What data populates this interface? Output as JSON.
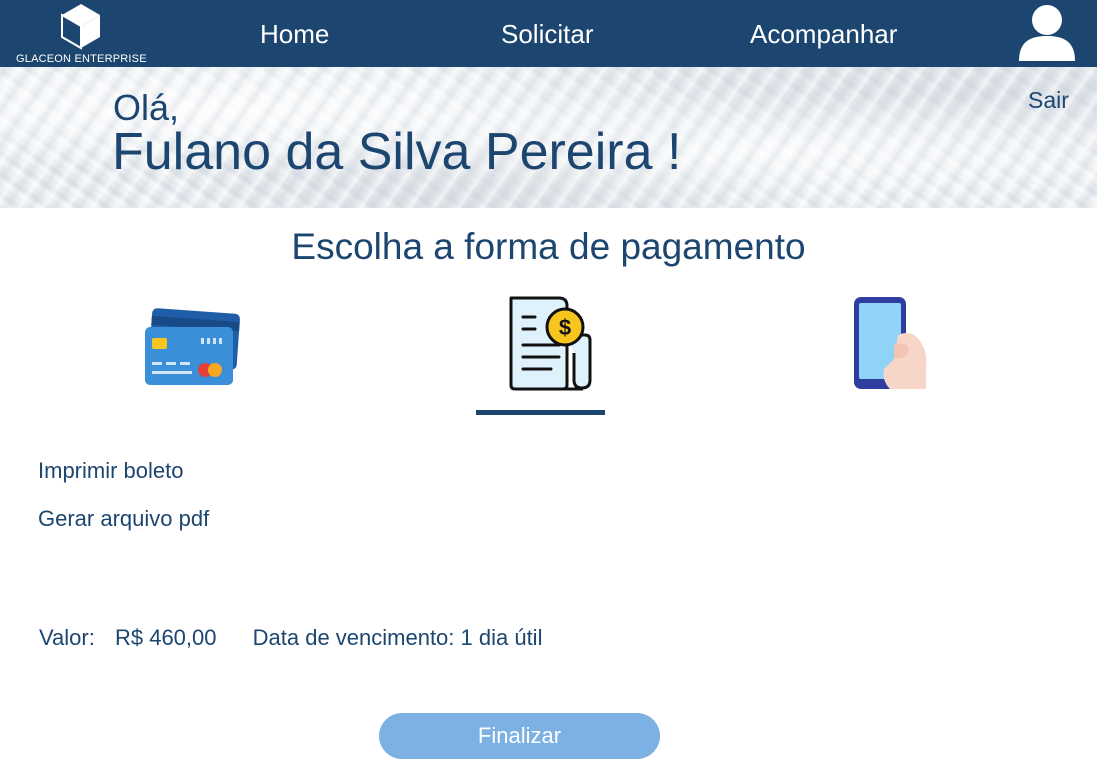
{
  "brand": {
    "name": "GLACEON ENTERPRISE"
  },
  "nav": {
    "items": [
      {
        "label": "Home"
      },
      {
        "label": "Solicitar"
      },
      {
        "label": "Acompanhar"
      }
    ],
    "avatar_icon": "user-icon"
  },
  "hero": {
    "greeting": "Olá,",
    "user_name": "Fulano da Silva Pereira !",
    "logout_label": "Sair"
  },
  "main": {
    "title": "Escolha a forma de pagamento",
    "payment_options": [
      {
        "icon": "credit-card-icon",
        "selected": false
      },
      {
        "icon": "boleto-bill-icon",
        "selected": true
      },
      {
        "icon": "mobile-phone-icon",
        "selected": false
      }
    ],
    "actions": [
      {
        "label": "Imprimir boleto"
      },
      {
        "label": "Gerar arquivo pdf"
      }
    ],
    "value_label": "Valor:",
    "value_amount": "R$ 460,00",
    "due_date": "Data de vencimento: 1 dia útil",
    "finalize_label": "Finalizar"
  },
  "colors": {
    "primary": "#1c4670",
    "button": "#7db0e3",
    "card_blue": "#2d7cc4",
    "coin_yellow": "#f7c51e",
    "paper_light": "#dff1fb"
  }
}
